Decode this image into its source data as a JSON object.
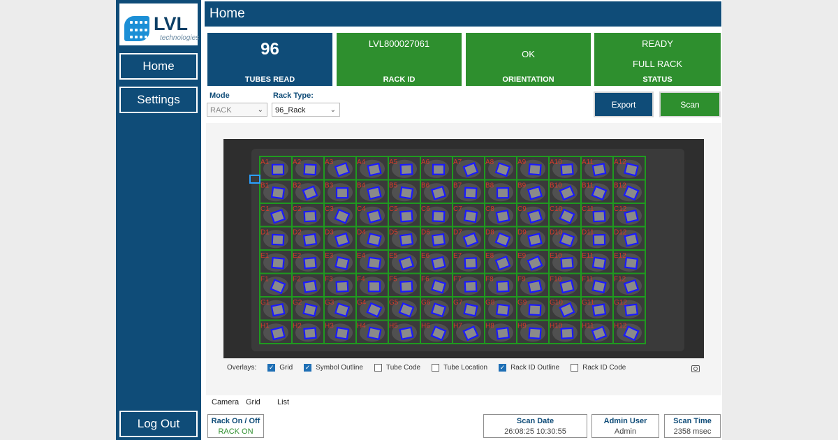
{
  "sidebar": {
    "logo_text": "LVL",
    "logo_sub": "technologies",
    "home": "Home",
    "settings": "Settings",
    "logout": "Log Out"
  },
  "header": {
    "title": "Home"
  },
  "cards": {
    "tubes_value": "96",
    "tubes_label": "TUBES READ",
    "rack_id_value": "LVL800027061",
    "rack_id_label": "RACK ID",
    "orientation_value": "OK",
    "orientation_label": "ORIENTATION",
    "status_line1": "READY",
    "status_line2": "FULL RACK",
    "status_label": "STATUS"
  },
  "controls": {
    "mode_label": "Mode",
    "mode_value": "RACK",
    "rack_type_label": "Rack Type:",
    "rack_type_value": "96_Rack",
    "export": "Export",
    "scan": "Scan"
  },
  "camera": {
    "rows": [
      "A",
      "B",
      "C",
      "D",
      "E",
      "F",
      "G",
      "H"
    ],
    "columns": [
      "1",
      "2",
      "3",
      "4",
      "5",
      "6",
      "7",
      "8",
      "9",
      "10",
      "11",
      "12"
    ]
  },
  "overlays": {
    "label": "Overlays:",
    "items": [
      {
        "label": "Grid",
        "checked": true
      },
      {
        "label": "Symbol Outline",
        "checked": true
      },
      {
        "label": "Tube Code",
        "checked": false
      },
      {
        "label": "Tube Location",
        "checked": false
      },
      {
        "label": "Rack ID Outline",
        "checked": true
      },
      {
        "label": "Rack ID Code",
        "checked": false
      }
    ]
  },
  "tabs": [
    "Camera",
    "Grid",
    "List"
  ],
  "statusbar": {
    "rack_onoff_label": "Rack On / Off",
    "rack_onoff_value": "RACK ON",
    "scan_date_label": "Scan Date",
    "scan_date_value": "26:08:25 10:30:55",
    "admin_label": "Admin User",
    "admin_value": "Admin",
    "scan_time_label": "Scan Time",
    "scan_time_value": "2358 msec"
  },
  "colors": {
    "brand_blue": "#0f4c78",
    "ok_green": "#2e8f2e",
    "grid_green": "#1f9a1f",
    "symbol_blue": "#1a1aff",
    "well_label_red": "#d33a2a"
  }
}
